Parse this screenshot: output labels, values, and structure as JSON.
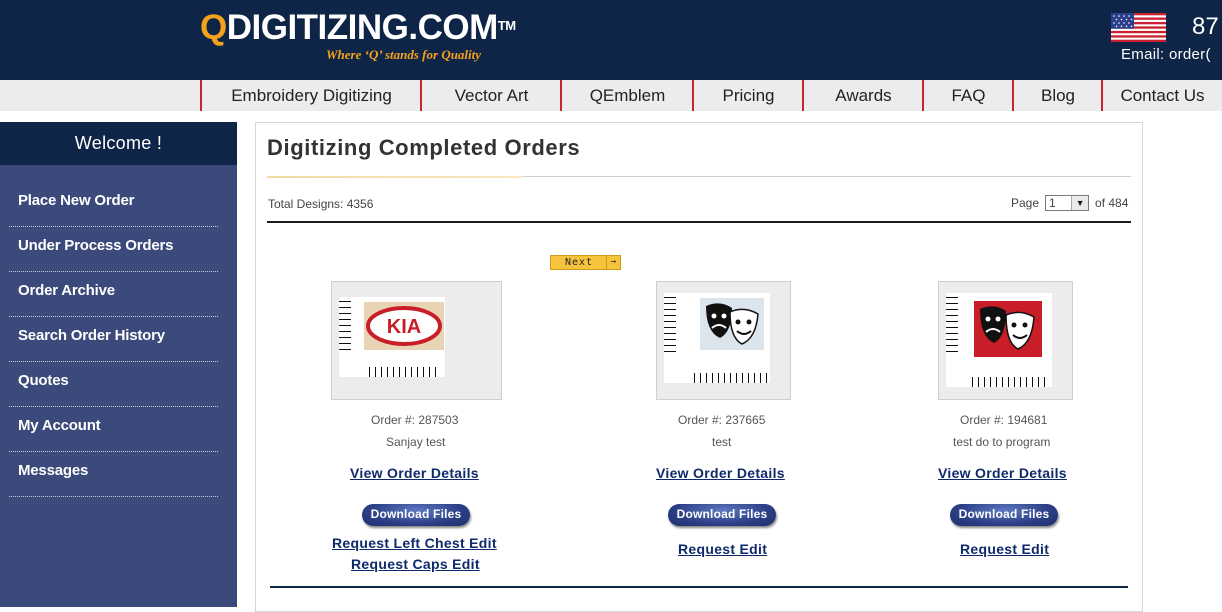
{
  "header": {
    "logo_q": "Q",
    "logo_rest": "DIGITIZING.COM",
    "logo_tm": "TM",
    "tagline": "Where ‘Q’ stands for Quality",
    "phone": "87",
    "email": "Email: order("
  },
  "nav": {
    "items": [
      "Embroidery Digitizing",
      "Vector Art",
      "QEmblem",
      "Pricing",
      "Awards",
      "FAQ",
      "Blog",
      "Contact Us"
    ]
  },
  "sidebar": {
    "welcome": "Welcome !",
    "items": [
      "Place New Order",
      "Under Process Orders",
      "Order Archive",
      "Search Order History",
      "Quotes",
      "My Account",
      "Messages"
    ]
  },
  "main": {
    "title": "Digitizing Completed Orders",
    "total": "Total Designs: 4356",
    "page_label": "Page",
    "page_value": "1",
    "page_of": "of 484",
    "next_label": "Next",
    "orders": [
      {
        "order_no": "Order #: 287503",
        "name": "Sanjay test",
        "view": "View Order Details",
        "download": "Download Files",
        "edits": [
          "Request Left Chest Edit",
          "Request Caps Edit"
        ],
        "thumb": "kia-logo"
      },
      {
        "order_no": "Order #: 237665",
        "name": "test",
        "view": "View Order Details",
        "download": "Download Files",
        "edits": [
          "Request Edit"
        ],
        "thumb": "theater-masks"
      },
      {
        "order_no": "Order #: 194681",
        "name": "test do to program",
        "view": "View Order Details",
        "download": "Download Files",
        "edits": [
          "Request Edit"
        ],
        "thumb": "theater-masks-red"
      }
    ]
  },
  "colors": {
    "header_bg": "#0e2547",
    "accent_orange": "#f4a21c",
    "nav_divider": "#c9252c",
    "sidebar_bg": "#3b4a7a",
    "link_blue": "#0f2a6b"
  }
}
